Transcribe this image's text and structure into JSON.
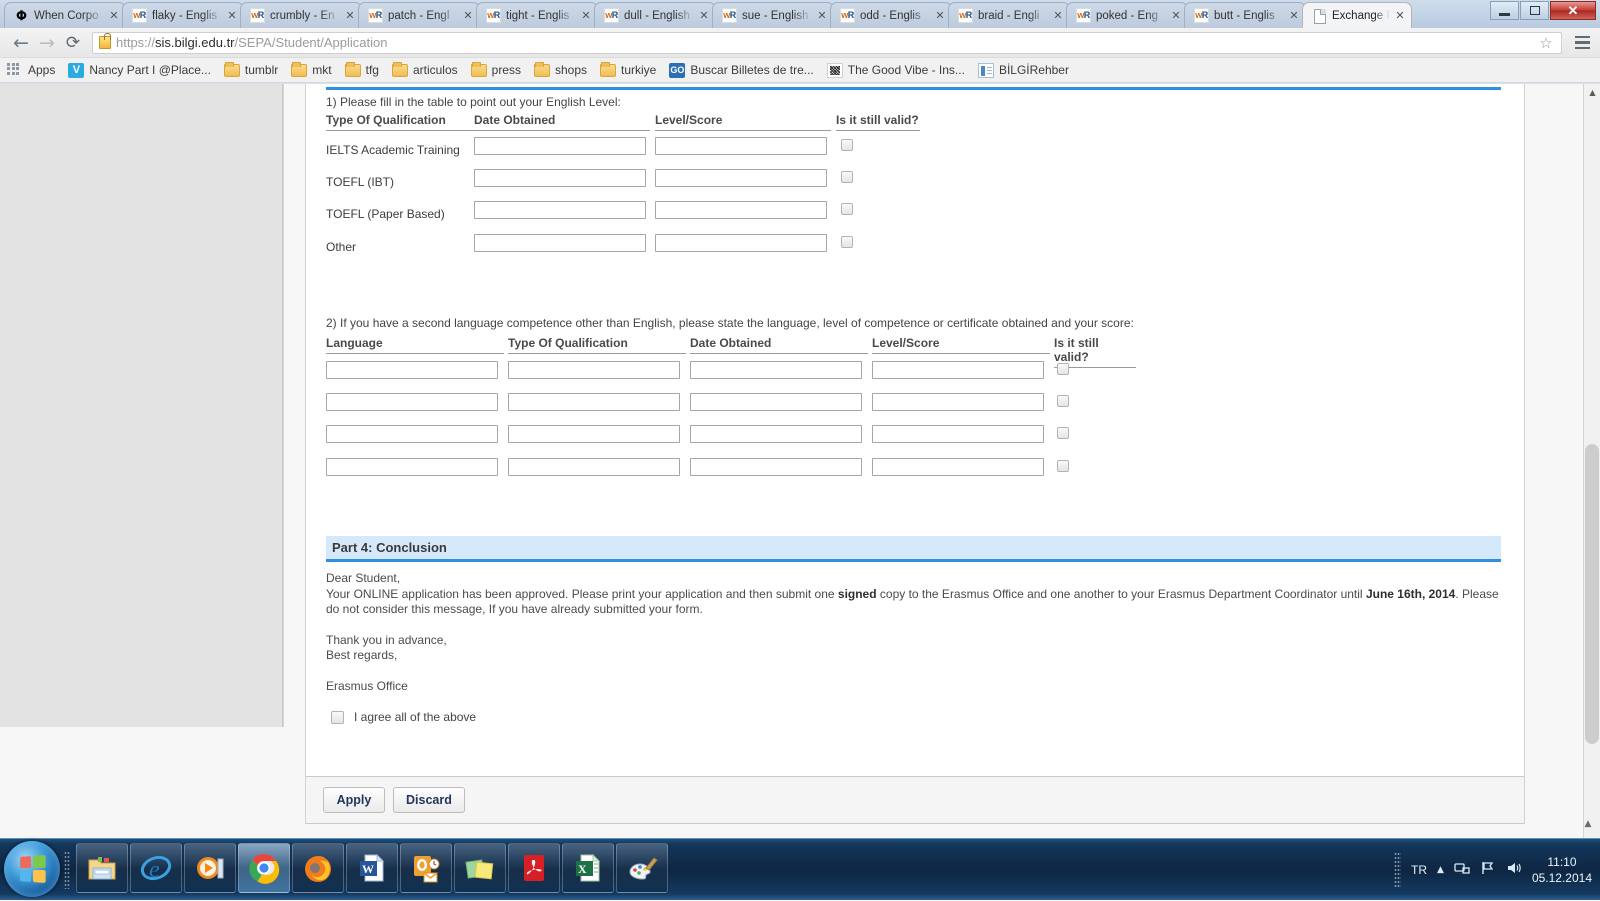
{
  "browser": {
    "tabs": [
      {
        "title": "When Corpo",
        "favicon": "nytimes-icon",
        "active": false
      },
      {
        "title": "flaky - Englis",
        "favicon": "wordreference-icon",
        "active": false
      },
      {
        "title": "crumbly - En",
        "favicon": "wordreference-icon",
        "active": false
      },
      {
        "title": "patch - Engl",
        "favicon": "wordreference-icon",
        "active": false
      },
      {
        "title": "tight - Englis",
        "favicon": "wordreference-icon",
        "active": false
      },
      {
        "title": "dull - English",
        "favicon": "wordreference-icon",
        "active": false
      },
      {
        "title": "sue - English",
        "favicon": "wordreference-icon",
        "active": false
      },
      {
        "title": "odd - Englis",
        "favicon": "wordreference-icon",
        "active": false
      },
      {
        "title": "braid - Engli",
        "favicon": "wordreference-icon",
        "active": false
      },
      {
        "title": "poked - Eng",
        "favicon": "wordreference-icon",
        "active": false
      },
      {
        "title": "butt - Englis",
        "favicon": "wordreference-icon",
        "active": false
      },
      {
        "title": "Exchange Pr",
        "favicon": "page-icon",
        "active": true
      }
    ],
    "close_glyph": "✕",
    "window_controls": {
      "minimize": "minimize-button",
      "maximize": "maximize-button",
      "close": "✕"
    },
    "nav": {
      "back": "←",
      "forward": "→",
      "reload": "⟳"
    },
    "url_scheme": "https://",
    "url_host": "sis.bilgi.edu.tr",
    "url_path": "/SEPA/Student/Application",
    "star_glyph": "☆",
    "bookmarks": [
      {
        "label": "Apps",
        "icon": "apps-grid-icon"
      },
      {
        "label": "Nancy Part I @Place...",
        "icon": "vimeo-icon"
      },
      {
        "label": "tumblr",
        "icon": "folder-icon"
      },
      {
        "label": "mkt",
        "icon": "folder-icon"
      },
      {
        "label": "tfg",
        "icon": "folder-icon"
      },
      {
        "label": "articulos",
        "icon": "folder-icon"
      },
      {
        "label": "press",
        "icon": "folder-icon"
      },
      {
        "label": "shops",
        "icon": "folder-icon"
      },
      {
        "label": "turkiye",
        "icon": "folder-icon"
      },
      {
        "label": "Buscar Billetes de tre...",
        "icon": "go-icon"
      },
      {
        "label": "The Good Vibe - Ins...",
        "icon": "noise-icon"
      },
      {
        "label": "BİLGİRehber",
        "icon": "document-icon"
      }
    ]
  },
  "form": {
    "q1": {
      "prompt": "1) Please fill in the table to point out your English Level:",
      "headers": [
        "Type Of Qualification",
        "Date Obtained",
        "Level/Score",
        "Is it still valid?"
      ],
      "rows": [
        {
          "qualification": "IELTS Academic Training",
          "date_obtained": "",
          "level_score": "",
          "valid": false
        },
        {
          "qualification": "TOEFL (IBT)",
          "date_obtained": "",
          "level_score": "",
          "valid": false
        },
        {
          "qualification": "TOEFL (Paper Based)",
          "date_obtained": "",
          "level_score": "",
          "valid": false
        },
        {
          "qualification": "Other",
          "date_obtained": "",
          "level_score": "",
          "valid": false
        }
      ]
    },
    "q2": {
      "prompt": "2) If you have a second language competence other than English, please state the language, level of competence or certificate obtained and your score:",
      "headers": [
        "Language",
        "Type Of Qualification",
        "Date Obtained",
        "Level/Score",
        "Is it still valid?"
      ],
      "rows": [
        {
          "language": "",
          "qualification": "",
          "date_obtained": "",
          "level_score": "",
          "valid": false
        },
        {
          "language": "",
          "qualification": "",
          "date_obtained": "",
          "level_score": "",
          "valid": false
        },
        {
          "language": "",
          "qualification": "",
          "date_obtained": "",
          "level_score": "",
          "valid": false
        },
        {
          "language": "",
          "qualification": "",
          "date_obtained": "",
          "level_score": "",
          "valid": false
        }
      ]
    },
    "part4": {
      "heading": "Part 4: Conclusion",
      "line1": "Dear Student,",
      "line2a": "Your ONLINE application has been approved. Please print your application and then submit one ",
      "line2_bold1": "signed",
      "line2b": " copy to the Erasmus Office and one another to your Erasmus Department Coordinator until ",
      "line2_bold2": "June 16th, 2014",
      "line2c": ". Please",
      "line3": "do not consider this message, If you have already submitted your form.",
      "line4": "Thank you in advance,",
      "line5": "Best regards,",
      "line6": "Erasmus Office",
      "agree_label": "I agree all of the above",
      "agree_checked": false
    },
    "footer": {
      "apply": "Apply",
      "discard": "Discard"
    }
  },
  "taskbar": {
    "start": "start-orb",
    "items": [
      {
        "name": "windows-explorer",
        "icon": "folder-explorer-icon"
      },
      {
        "name": "internet-explorer",
        "icon": "ie-icon"
      },
      {
        "name": "windows-media-player",
        "icon": "media-player-icon"
      },
      {
        "name": "google-chrome",
        "icon": "chrome-icon",
        "active": true
      },
      {
        "name": "mozilla-firefox",
        "icon": "firefox-icon"
      },
      {
        "name": "microsoft-word",
        "icon": "word-icon"
      },
      {
        "name": "microsoft-outlook",
        "icon": "outlook-icon"
      },
      {
        "name": "sticky-notes",
        "icon": "sticky-notes-icon"
      },
      {
        "name": "adobe-reader",
        "icon": "acrobat-icon"
      },
      {
        "name": "microsoft-excel",
        "icon": "excel-icon"
      },
      {
        "name": "microsoft-paint",
        "icon": "paint-icon"
      }
    ],
    "tray": {
      "language": "TR",
      "show_hidden": "▲",
      "network": "network-icon",
      "action_center": "flag-icon",
      "volume": "◄)",
      "time": "11:10",
      "date": "05.12.2014"
    }
  }
}
